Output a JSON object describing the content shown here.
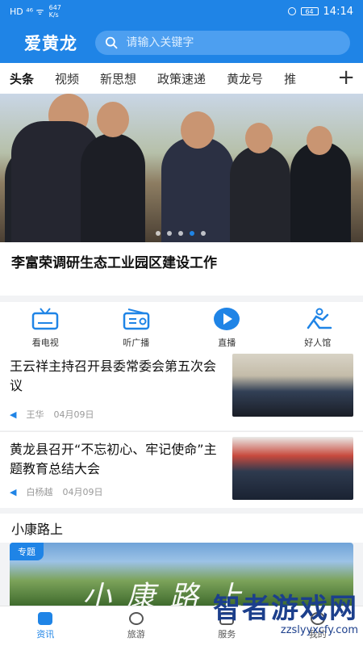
{
  "status_bar": {
    "left": "HD ⁴⁶ ᯤ",
    "speed": "647 K/s",
    "time": "14:14",
    "battery": "64"
  },
  "header": {
    "brand": "爱黄龙",
    "search_placeholder": "请输入关键字"
  },
  "tabs": [
    "头条",
    "视频",
    "新思想",
    "政策速递",
    "黄龙号",
    "推"
  ],
  "hero": {
    "headline": "李富荣调研生态工业园区建设工作",
    "slide_count": 5,
    "active_slide": 4
  },
  "quick_links": [
    {
      "label": "看电视",
      "icon": "tv-icon"
    },
    {
      "label": "听广播",
      "icon": "radio-icon"
    },
    {
      "label": "直播",
      "icon": "play-icon"
    },
    {
      "label": "好人馆",
      "icon": "figure-icon"
    }
  ],
  "news": [
    {
      "title": "王云祥主持召开县委常委会第五次会议",
      "author": "王华",
      "date": "04月09日"
    },
    {
      "title": "黄龙县召开“不忘初心、牢记使命”主题教育总结大会",
      "author": "白杨越",
      "date": "04月09日"
    }
  ],
  "section": {
    "title": "小康路上",
    "badge": "专题",
    "banner_text": "小康路上"
  },
  "bottom_nav": [
    {
      "label": "资讯",
      "active": true
    },
    {
      "label": "旅游",
      "active": false
    },
    {
      "label": "服务",
      "active": false
    },
    {
      "label": "我的",
      "active": false
    }
  ],
  "watermark": {
    "title": "智者游戏网",
    "url": "zzslyyxcfy.com"
  },
  "colors": {
    "primary": "#1f84e6",
    "accent_dot": "#1f84e6"
  }
}
